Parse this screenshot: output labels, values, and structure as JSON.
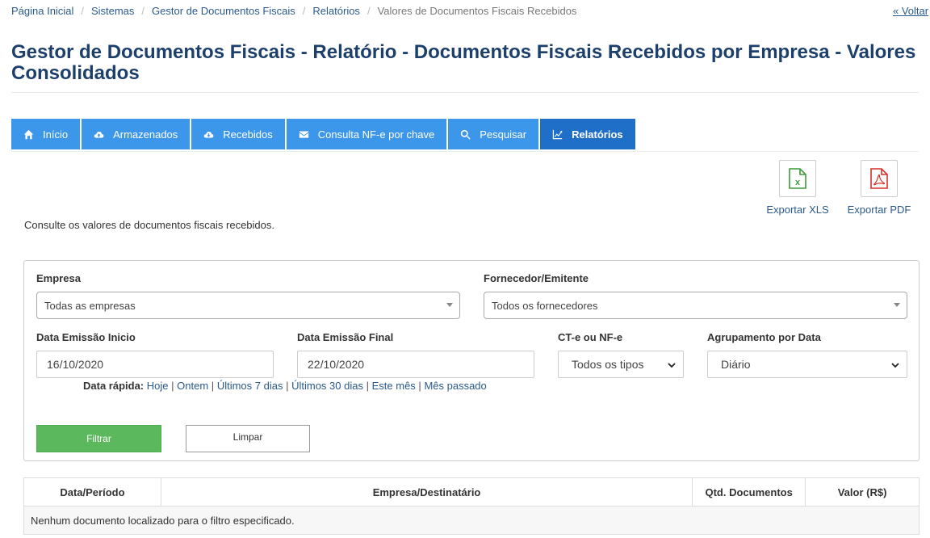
{
  "breadcrumb": {
    "items": [
      "Página Inicial",
      "Sistemas",
      "Gestor de Documentos Fiscais",
      "Relatórios"
    ],
    "current": "Valores de Documentos Fiscais Recebidos",
    "back": "« Voltar"
  },
  "page": {
    "title": "Gestor de Documentos Fiscais - Relatório - Documentos Fiscais Recebidos por Empresa - Valores Consolidados",
    "intro": "Consulte os valores de documentos fiscais recebidos."
  },
  "tabs": [
    {
      "label": "Início",
      "icon": "home-icon"
    },
    {
      "label": "Armazenados",
      "icon": "cloud-upload-icon"
    },
    {
      "label": "Recebidos",
      "icon": "cloud-download-icon"
    },
    {
      "label": "Consulta NF-e por chave",
      "icon": "envelope-icon"
    },
    {
      "label": "Pesquisar",
      "icon": "search-icon"
    },
    {
      "label": "Relatórios",
      "icon": "line-chart-icon",
      "active": true
    }
  ],
  "export": {
    "xls": {
      "label": "Exportar XLS",
      "icon": "excel-file-icon",
      "color": "#3c9c3c"
    },
    "pdf": {
      "label": "Exportar PDF",
      "icon": "pdf-file-icon",
      "color": "#d9302c"
    }
  },
  "filters": {
    "empresa_label": "Empresa",
    "empresa_value": "Todas as empresas",
    "fornecedor_label": "Fornecedor/Emitente",
    "fornecedor_value": "Todos os fornecedores",
    "data_inicio_label": "Data Emissão Inicio",
    "data_inicio_value": "16/10/2020",
    "data_final_label": "Data Emissão Final",
    "data_final_value": "22/10/2020",
    "tipo_label": "CT-e ou NF-e",
    "tipo_value": "Todos os tipos",
    "agrupamento_label": "Agrupamento por Data",
    "agrupamento_value": "Diário",
    "quick_label": "Data rápida:",
    "quick_links": [
      "Hoje",
      "Ontem",
      "Últimos 7 dias",
      "Últimos 30 dias",
      "Este mês",
      "Mês passado"
    ],
    "quick_separator": "|",
    "filter_button": "Filtrar",
    "clear_button": "Limpar"
  },
  "table": {
    "headers": [
      "Data/Período",
      "Empresa/Destinatário",
      "Qtd. Documentos",
      "Valor (R$)"
    ],
    "empty_message": "Nenhum documento localizado para o filtro especificado."
  },
  "colors": {
    "tab": "#3c97ea",
    "tab_active": "#1f6fc8",
    "title": "#1d3f6b",
    "link": "#2a5a8a",
    "filter_button": "#5cb85c"
  }
}
